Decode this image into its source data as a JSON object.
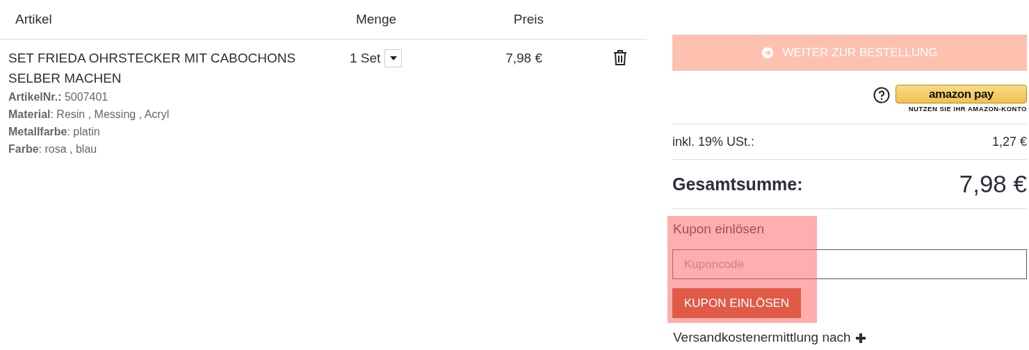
{
  "cart": {
    "columns": [
      "Artikel",
      "Menge",
      "Preis"
    ],
    "items": [
      {
        "title": "SET FRIEDA OHRSTECKER MIT CABOCHONS SELBER MACHEN",
        "details": [
          "**ArtikelNr.:** 5007401",
          "**Material**: Resin , Messing , Acryl",
          "**Metallfarbe**: platin",
          "**Farbe**: rosa , blau"
        ],
        "quantity": "1 Set",
        "price": "7,98 €"
      }
    ]
  },
  "summary": {
    "checkout_button": "WEITER ZUR BESTELLUNG",
    "amazon_pay": {
      "logo": "amazon pay",
      "caption": "NUTZEN SIE IHR AMAZON-KONTO"
    },
    "tax": {
      "label": "inkl. 19% USt.:",
      "value": "1,27 €"
    },
    "total": {
      "label": "Gesamtsumme:",
      "value": "7,98 €"
    },
    "coupon": {
      "heading": "Kupon einlösen",
      "placeholder": "Kuponcode",
      "button": "KUPON EINLÖSEN"
    },
    "shipping": "Versandkostenermittlung nach"
  }
}
